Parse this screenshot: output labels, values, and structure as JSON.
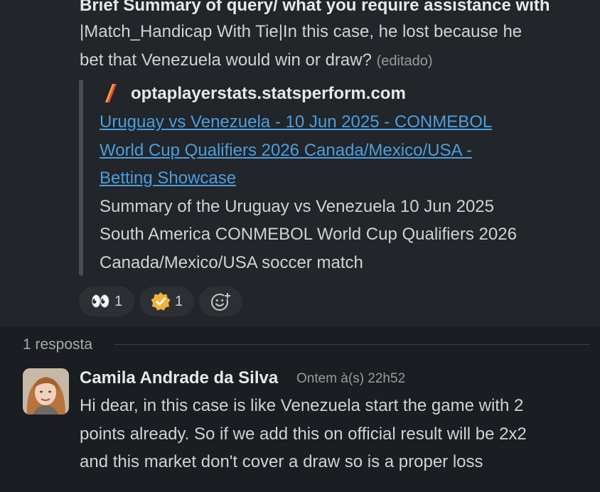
{
  "message": {
    "line1": "Brief Summary of query/ what you require assistance with",
    "line2": "|Match_Handicap With Tie|In this case, he lost because he",
    "line3": "bet that Venezuela would win or draw?",
    "edited": "(editado)"
  },
  "unfurl": {
    "site": "optaplayerstats.statsperform.com",
    "link_lines": [
      "Uruguay vs Venezuela - 10 Jun 2025 - CONMEBOL",
      "World Cup Qualifiers 2026 Canada/Mexico/USA -",
      "Betting Showcase"
    ],
    "desc_lines": [
      "Summary of the Uruguay vs Venezuela 10 Jun 2025",
      "South America CONMEBOL World Cup Qualifiers 2026",
      "Canada/Mexico/USA soccer match"
    ]
  },
  "reactions": [
    {
      "emoji": "👀",
      "count": "1",
      "icon": "eyes-icon"
    },
    {
      "emoji": "✔",
      "count": "1",
      "icon": "verified-badge-icon"
    }
  ],
  "add_reaction_icon": "add-reaction-icon",
  "thread": {
    "reply_count": "1 resposta"
  },
  "reply": {
    "author": "Camila Andrade da Silva",
    "timestamp": "Ontem à(s) 22h52",
    "lines": [
      "Hi dear, in this case is like Venezuela start the game with 2",
      "points already. So if we add this on official result will be 2x2",
      "and this market don't cover a draw so is a proper loss"
    ]
  },
  "colors": {
    "link": "#4a9fe0",
    "background": "#1a1d21",
    "message_bg": "#222529"
  }
}
